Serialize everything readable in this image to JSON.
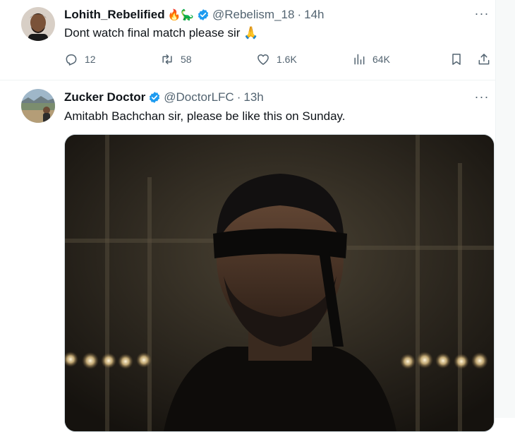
{
  "tweets": [
    {
      "display_name": "Lohith_Rebelified",
      "name_emojis": "🔥🦕",
      "handle": "@Rebelism_18",
      "separator": "·",
      "time": "14h",
      "text": "Dont watch final match please sir 🙏",
      "stats": {
        "replies": "12",
        "retweets": "58",
        "likes": "1.6K",
        "views": "64K"
      }
    },
    {
      "display_name": "Zucker Doctor",
      "handle": "@DoctorLFC",
      "separator": "·",
      "time": "13h",
      "text": "Amitabh Bachchan sir, please be like this on Sunday."
    }
  ],
  "icons": {
    "verified": "verified-badge-icon",
    "more": "more-icon",
    "reply": "reply-icon",
    "retweet": "retweet-icon",
    "like": "heart-icon",
    "views": "views-icon",
    "bookmark": "bookmark-icon",
    "share": "share-icon"
  },
  "colors": {
    "verified_blue": "#1d9bf0",
    "text_primary": "#0f1419",
    "text_secondary": "#536471",
    "border": "#eff3f4"
  },
  "more_glyph": "···"
}
